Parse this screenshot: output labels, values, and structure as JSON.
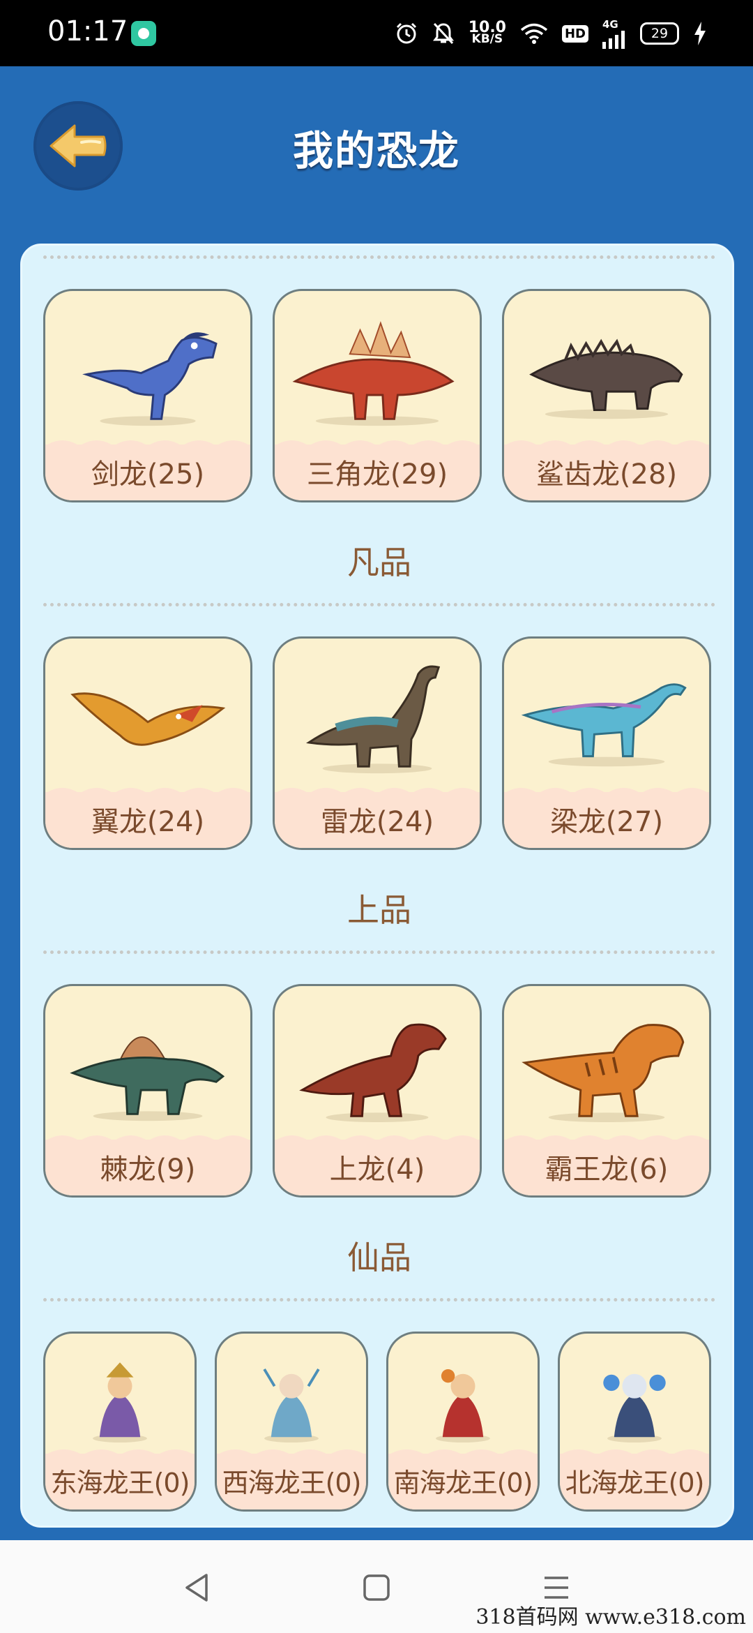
{
  "status_bar": {
    "time": "01:17",
    "net_speed_value": "10.0",
    "net_speed_unit": "KB/S",
    "hd_label": "HD",
    "network_type": "4G",
    "battery_level": "29",
    "icons": [
      "alarm-icon",
      "mute-icon",
      "wifi-icon",
      "signal-icon",
      "battery-icon",
      "charging-icon"
    ]
  },
  "header": {
    "title": "我的恐龙",
    "back_icon": "back-arrow-icon"
  },
  "sections": [
    {
      "tier": "凡品",
      "cards": [
        {
          "name": "剑龙(25)",
          "color": "#4f6fc8"
        },
        {
          "name": "三角龙(29)",
          "color": "#c9462f"
        },
        {
          "name": "鲨齿龙(28)",
          "color": "#5a4a45"
        }
      ]
    },
    {
      "tier": "上品",
      "cards": [
        {
          "name": "翼龙(24)",
          "color": "#e39b2f"
        },
        {
          "name": "雷龙(24)",
          "color": "#4e8f9a"
        },
        {
          "name": "梁龙(27)",
          "color": "#5bb7d2"
        }
      ]
    },
    {
      "tier": "仙品",
      "cards": [
        {
          "name": "棘龙(9)",
          "color": "#3f6b5e"
        },
        {
          "name": "上龙(4)",
          "color": "#9a3a28"
        },
        {
          "name": "霸王龙(6)",
          "color": "#e0822f"
        }
      ]
    },
    {
      "tier": "",
      "cards": [
        {
          "name": "东海龙王(0)",
          "color": "#c79a34"
        },
        {
          "name": "西海龙王(0)",
          "color": "#6fa8c8"
        },
        {
          "name": "南海龙王(0)",
          "color": "#b6322e"
        },
        {
          "name": "北海龙王(0)",
          "color": "#3a4f7a"
        }
      ]
    }
  ],
  "nav": {
    "back": "back-triangle-icon",
    "home": "home-square-icon",
    "menu": "menu-lines-icon"
  },
  "watermark": "318首码网 www.e318.com",
  "colors": {
    "background": "#246cb6",
    "panel": "#dcf3fc",
    "card": "#fbf1cf",
    "card_wave": "#fde2d2",
    "text_brown": "#7a4a2c"
  }
}
